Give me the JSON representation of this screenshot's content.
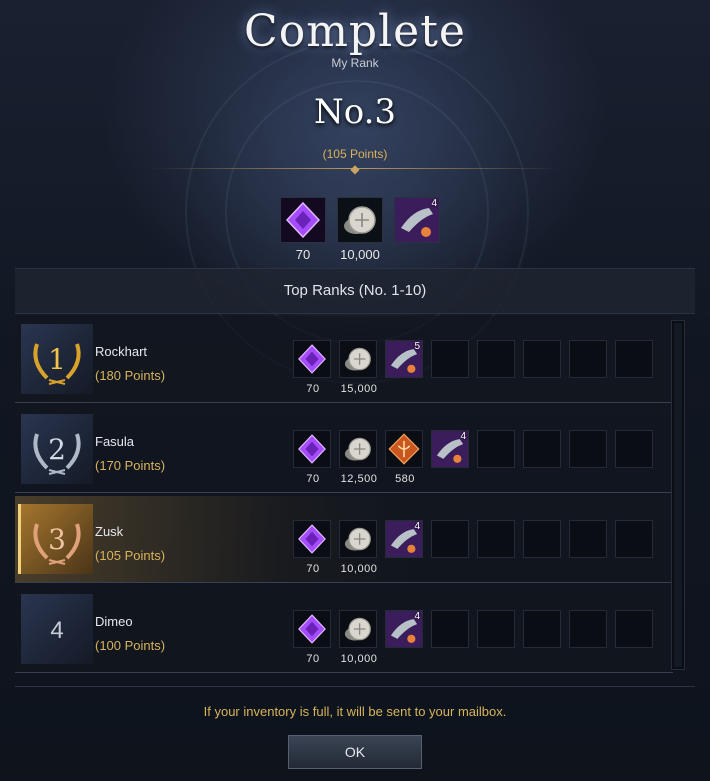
{
  "header": {
    "title": "Complete",
    "my_rank_label": "My Rank",
    "rank": "No.3",
    "points": "(105 Points)"
  },
  "my_rewards": [
    {
      "icon": "purple-gem-icon",
      "value": "70"
    },
    {
      "icon": "silver-coin-icon",
      "value": "10,000"
    },
    {
      "icon": "fish-card-icon",
      "qty": "4"
    }
  ],
  "top_ranks": {
    "title": "Top Ranks (No. 1-10)",
    "rows": [
      {
        "rank": "1",
        "name": "Rockhart",
        "points": "(180 Points)",
        "medal": "gold-laurel-icon",
        "rewards": [
          {
            "icon": "purple-gem-icon",
            "value": "70"
          },
          {
            "icon": "silver-coin-icon",
            "value": "15,000"
          },
          {
            "icon": "fish-card-icon",
            "qty": "5"
          }
        ]
      },
      {
        "rank": "2",
        "name": "Fasula",
        "points": "(170 Points)",
        "medal": "silver-laurel-icon",
        "rewards": [
          {
            "icon": "purple-gem-icon",
            "value": "70"
          },
          {
            "icon": "silver-coin-icon",
            "value": "12,500"
          },
          {
            "icon": "orange-crest-icon",
            "value": "580"
          },
          {
            "icon": "fish-card-icon",
            "qty": "4"
          }
        ]
      },
      {
        "rank": "3",
        "name": "Zusk",
        "points": "(105 Points)",
        "medal": "bronze-laurel-icon",
        "highlighted": true,
        "rewards": [
          {
            "icon": "purple-gem-icon",
            "value": "70"
          },
          {
            "icon": "silver-coin-icon",
            "value": "10,000"
          },
          {
            "icon": "fish-card-icon",
            "qty": "4"
          }
        ]
      },
      {
        "rank": "4",
        "name": "Dimeo",
        "points": "(100 Points)",
        "medal": "",
        "rewards": [
          {
            "icon": "purple-gem-icon",
            "value": "70"
          },
          {
            "icon": "silver-coin-icon",
            "value": "10,000"
          },
          {
            "icon": "fish-card-icon",
            "qty": "4"
          }
        ]
      }
    ]
  },
  "footer": {
    "notice": "If your inventory is full, it will be sent to your mailbox.",
    "ok_label": "OK"
  },
  "colors": {
    "gold_text": "#d8b35a",
    "highlight": "#f2d27a",
    "gem_purple": "#a64cff"
  }
}
